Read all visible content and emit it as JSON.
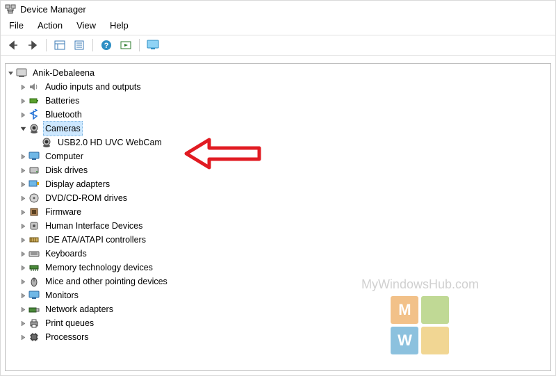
{
  "window": {
    "title": "Device Manager"
  },
  "menu": {
    "items": [
      "File",
      "Action",
      "View",
      "Help"
    ]
  },
  "toolbar": {
    "back": "back-arrow-icon",
    "forward": "forward-arrow-icon",
    "show_hidden": "show-hidden-icon",
    "properties": "properties-icon",
    "help": "help-icon",
    "scan": "scan-hardware-icon",
    "monitor": "monitor-icon"
  },
  "tree": {
    "root": {
      "label": "Anik-Debaleena",
      "icon": "computer-root-icon",
      "expanded": true
    },
    "nodes": [
      {
        "label": "Audio inputs and outputs",
        "icon": "speaker-icon",
        "expanded": false
      },
      {
        "label": "Batteries",
        "icon": "battery-icon",
        "expanded": false
      },
      {
        "label": "Bluetooth",
        "icon": "bluetooth-icon",
        "expanded": false
      },
      {
        "label": "Cameras",
        "icon": "camera-icon",
        "expanded": true,
        "selected": true,
        "children": [
          {
            "label": "USB2.0 HD UVC WebCam",
            "icon": "camera-icon"
          }
        ]
      },
      {
        "label": "Computer",
        "icon": "monitor-device-icon",
        "expanded": false
      },
      {
        "label": "Disk drives",
        "icon": "disk-drive-icon",
        "expanded": false
      },
      {
        "label": "Display adapters",
        "icon": "display-adapter-icon",
        "expanded": false
      },
      {
        "label": "DVD/CD-ROM drives",
        "icon": "optical-drive-icon",
        "expanded": false
      },
      {
        "label": "Firmware",
        "icon": "firmware-icon",
        "expanded": false
      },
      {
        "label": "Human Interface Devices",
        "icon": "hid-icon",
        "expanded": false
      },
      {
        "label": "IDE ATA/ATAPI controllers",
        "icon": "ide-controller-icon",
        "expanded": false
      },
      {
        "label": "Keyboards",
        "icon": "keyboard-icon",
        "expanded": false
      },
      {
        "label": "Memory technology devices",
        "icon": "memory-icon",
        "expanded": false
      },
      {
        "label": "Mice and other pointing devices",
        "icon": "mouse-icon",
        "expanded": false
      },
      {
        "label": "Monitors",
        "icon": "monitor-device-icon",
        "expanded": false
      },
      {
        "label": "Network adapters",
        "icon": "network-adapter-icon",
        "expanded": false
      },
      {
        "label": "Print queues",
        "icon": "printer-icon",
        "expanded": false
      },
      {
        "label": "Processors",
        "icon": "processor-icon",
        "expanded": false
      }
    ]
  },
  "watermark": {
    "text": "MyWindowsHub.com",
    "tiles": [
      {
        "bg": "#e88f2a",
        "letter": "M"
      },
      {
        "bg": "#8dbb3f",
        "letter": ""
      },
      {
        "bg": "#2f8fc4",
        "letter": "W"
      },
      {
        "bg": "#e7b63c",
        "letter": ""
      }
    ]
  },
  "annotation": {
    "arrow_color": "#e11b22"
  }
}
